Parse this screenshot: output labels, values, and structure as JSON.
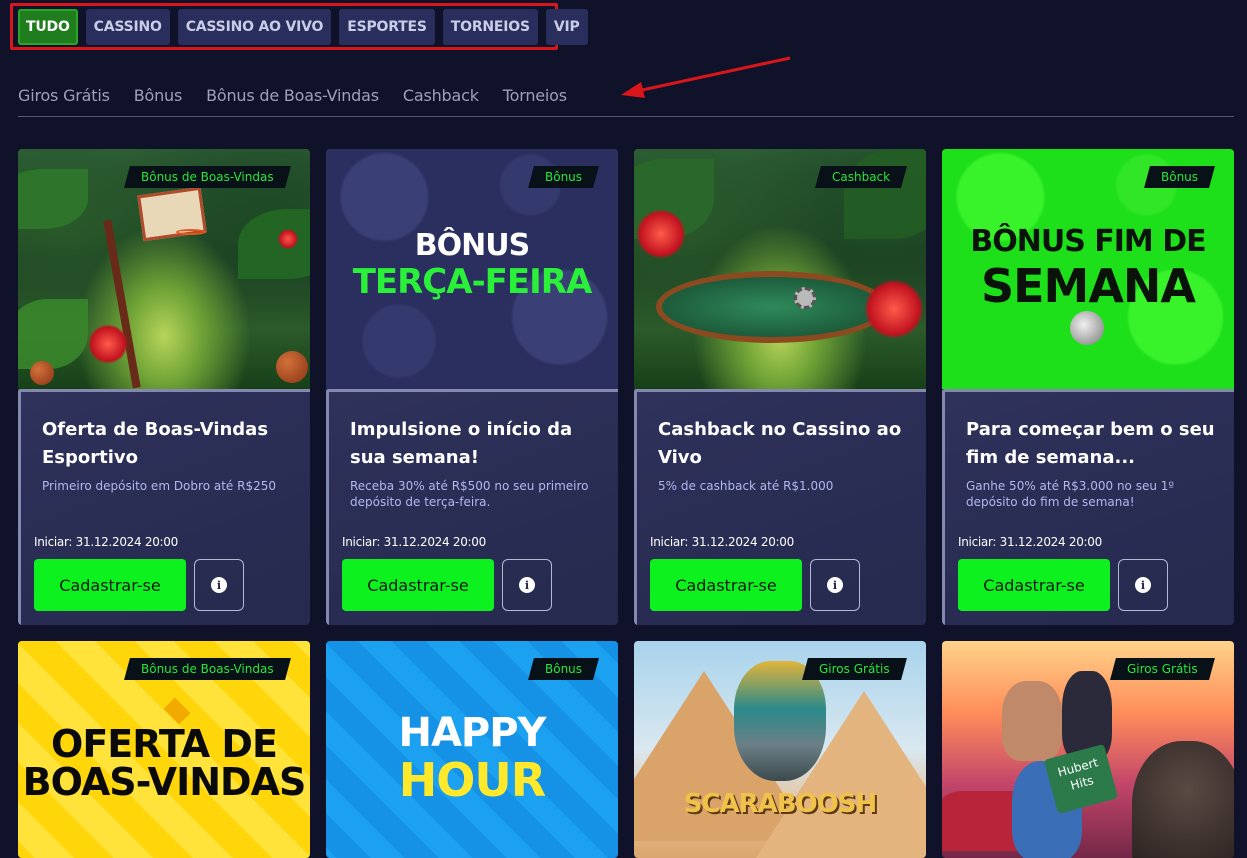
{
  "category_tabs": [
    {
      "label": "TUDO",
      "active": true
    },
    {
      "label": "CASSINO",
      "active": false
    },
    {
      "label": "CASSINO AO VIVO",
      "active": false
    },
    {
      "label": "ESPORTES",
      "active": false
    },
    {
      "label": "TORNEIOS",
      "active": false
    },
    {
      "label": "VIP",
      "active": false
    }
  ],
  "sub_tabs": [
    "Giros Grátis",
    "Bônus",
    "Bônus de Boas-Vindas",
    "Cashback",
    "Torneios"
  ],
  "cards": [
    {
      "tag": "Bônus de Boas-Vindas",
      "title": "Oferta de Boas-Vindas Esportivo",
      "description": "Primeiro depósito em Dobro até R$250",
      "start": "Iniciar: 31.12.2024 20:00",
      "register_label": "Cadastrar-se",
      "art": "basketball-jungle"
    },
    {
      "tag": "Bônus",
      "title": "Impulsione o início da sua semana!",
      "description": "Receba 30% até R$500 no seu primeiro depósito de terça-feira.",
      "start": "Iniciar: 31.12.2024 20:00",
      "register_label": "Cadastrar-se",
      "art_text": [
        "BÔNUS",
        "TERÇA-FEIRA"
      ]
    },
    {
      "tag": "Cashback",
      "title": "Cashback no Cassino ao Vivo",
      "description": "5% de cashback até R$1.000",
      "start": "Iniciar: 31.12.2024 20:00",
      "register_label": "Cadastrar-se",
      "art": "poker-table-jungle"
    },
    {
      "tag": "Bônus",
      "title": "Para começar bem o seu fim de semana...",
      "description": "Ganhe 50% até R$3.000 no seu 1º depósito do fim de semana!",
      "start": "Iniciar: 31.12.2024 20:00",
      "register_label": "Cadastrar-se",
      "art_text": [
        "BÔNUS FIM DE",
        "SEMANA"
      ]
    }
  ],
  "cards_row2": [
    {
      "tag": "Bônus de Boas-Vindas",
      "art_text": [
        "OFERTA DE",
        "BOAS-VINDAS"
      ]
    },
    {
      "tag": "Bônus",
      "art_text": [
        "HAPPY",
        "HOUR"
      ]
    },
    {
      "tag": "Giros Grátis",
      "art_text": [
        "SCARABOOSH"
      ]
    },
    {
      "tag": "Giros Grátis",
      "art_text": [
        "Hubert",
        "Hits"
      ]
    }
  ],
  "colors": {
    "background": "#0f1229",
    "accent_green": "#0df21f",
    "active_tab": "#1f7d1d",
    "annotation_red": "#d9161b"
  },
  "icons": {
    "info": "info-circle-icon",
    "arrow": "red-annotation-arrow"
  }
}
